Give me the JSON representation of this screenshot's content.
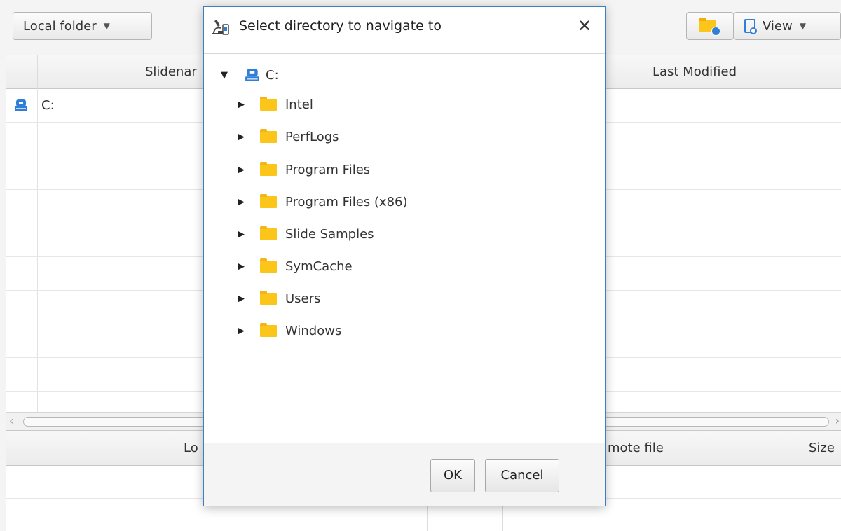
{
  "toolbar": {
    "local_folder": "Local folder",
    "view": "View"
  },
  "browser_table": {
    "columns": [
      "Slidenar",
      "Last Modified"
    ],
    "rows": [
      "C:"
    ]
  },
  "transfer_table": {
    "columns": [
      "Lo",
      "mote file",
      "Size"
    ]
  },
  "dialog": {
    "title": "Select directory to navigate to",
    "root": "C:",
    "folders": [
      "Intel",
      "PerfLogs",
      "Program Files",
      "Program Files (x86)",
      "Slide Samples",
      "SymCache",
      "Users",
      "Windows"
    ],
    "ok": "OK",
    "cancel": "Cancel",
    "close_glyph": "✕"
  },
  "icons": {
    "drive": "drive-icon",
    "folder": "folder-icon",
    "new_folder": "new-folder-icon",
    "view": "view-icon",
    "app": "microscope-icon",
    "expand": "triangle-right-icon",
    "collapse": "triangle-down-icon"
  },
  "colors": {
    "dialog_border": "#3c7fc0",
    "folder": "#fcc51a",
    "drive": "#2f7ed8"
  }
}
